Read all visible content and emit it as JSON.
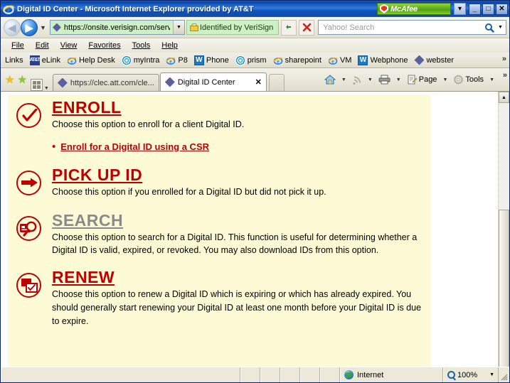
{
  "window": {
    "title": "Digital ID Center - Microsoft Internet Explorer provided by AT&T",
    "mcafee_label": "McAfee",
    "minimize_label": "_",
    "maximize_label": "□",
    "close_label": "✕",
    "mcafee_dropdown_label": "▾"
  },
  "address_bar": {
    "back_label": "◀",
    "forward_label": "▶",
    "history_dropdown_label": "▼",
    "url": "https://onsite.verisign.com/serv",
    "url_dropdown_label": "▼",
    "security_label": "Identified by VeriSign",
    "refresh_label": "↻",
    "stop_label": "✕",
    "search_placeholder": "Yahoo! Search",
    "search_value": "",
    "search_go_label": "⌕",
    "search_dropdown_label": "▼"
  },
  "menu_bar": {
    "items": [
      {
        "label": "File",
        "accel": "F"
      },
      {
        "label": "Edit",
        "accel": "E"
      },
      {
        "label": "View",
        "accel": "V"
      },
      {
        "label": "Favorites",
        "accel": "a"
      },
      {
        "label": "Tools",
        "accel": "T"
      },
      {
        "label": "Help",
        "accel": "H"
      }
    ]
  },
  "links_bar": {
    "label": "Links",
    "overflow_label": "»",
    "items": [
      {
        "label": "eLink",
        "icon": "elink-icon"
      },
      {
        "label": "Help Desk",
        "icon": "ie-icon"
      },
      {
        "label": "myIntra",
        "icon": "att-globe-icon"
      },
      {
        "label": "P8",
        "icon": "ie-icon"
      },
      {
        "label": "Phone",
        "icon": "w-icon"
      },
      {
        "label": "prism",
        "icon": "att-globe-icon"
      },
      {
        "label": "sharepoint",
        "icon": "ie-icon"
      },
      {
        "label": "VM",
        "icon": "ie-icon"
      },
      {
        "label": "Webphone",
        "icon": "w-icon"
      },
      {
        "label": "webster",
        "icon": "diamond-icon"
      }
    ]
  },
  "tab_bar": {
    "add_favorite_label": "★",
    "favorites_center_label": "★",
    "quick_tabs_dropdown_label": "▼",
    "tabs": [
      {
        "title": "https://clec.att.com/cle...",
        "active": false,
        "close_label": "✕"
      },
      {
        "title": "Digital ID Center",
        "active": true,
        "close_label": "✕"
      }
    ],
    "commands": [
      {
        "label": "",
        "icon": "home-icon",
        "dropdown": "▼"
      },
      {
        "label": "",
        "icon": "feeds-icon",
        "dropdown": "▼"
      },
      {
        "label": "",
        "icon": "print-icon",
        "dropdown": "▼"
      },
      {
        "label": "Page",
        "icon": "page-icon",
        "dropdown": "▼"
      },
      {
        "label": "Tools",
        "icon": "tools-gear-icon",
        "dropdown": "▼"
      }
    ],
    "overflow_label": "»"
  },
  "page_content": {
    "sections": [
      {
        "icon": "check-circle-icon",
        "heading": "ENROLL",
        "visited": false,
        "description": "Choose this option to enroll for a client Digital ID.",
        "bullets": [
          {
            "label": "Enroll for a Digital ID using a CSR"
          }
        ]
      },
      {
        "icon": "arrow-circle-icon",
        "heading": "PICK UP ID",
        "visited": false,
        "description": "Choose this option if you enrolled for a Digital ID but did not pick it up.",
        "bullets": []
      },
      {
        "icon": "magnifier-circle-icon",
        "heading": "SEARCH",
        "visited": true,
        "description": "Choose this option to search for a Digital ID. This function is useful for determining whether a Digital ID is valid, expired, or revoked. You may also download IDs from this option.",
        "bullets": []
      },
      {
        "icon": "renew-circle-icon",
        "heading": "RENEW",
        "visited": false,
        "description": "Choose this option to renew a Digital ID which is expiring or which has already expired. You should generally start renewing your Digital ID at least one month before your Digital ID is due to expire.",
        "bullets": []
      }
    ]
  },
  "scrollbar": {
    "up_label": "▲",
    "down_label": "▼"
  },
  "status_bar": {
    "message": "",
    "zone_label": "Internet",
    "zoom_label": "100%",
    "zoom_dropdown_label": "▼"
  },
  "colors": {
    "heading_red": "#c00000",
    "heading_visited": "#8a8a8a",
    "panel_bg": "#fcfbd5",
    "titlebar_blue": "#0b44a8",
    "mcafee_green": "#63b51b",
    "secure_green": "#cdf0c4"
  }
}
